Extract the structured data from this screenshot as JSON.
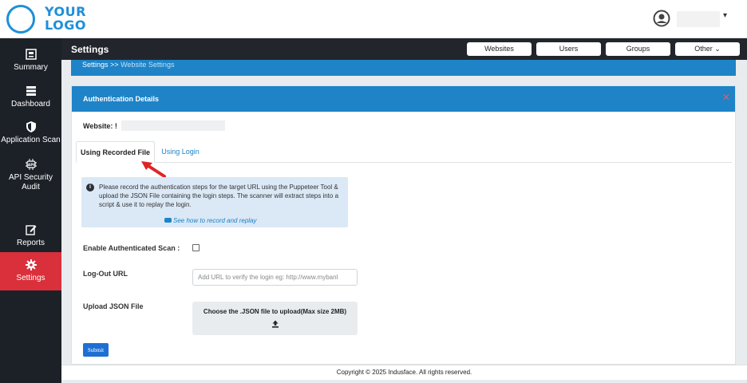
{
  "logo": {
    "line1": "YOUR",
    "line2": "LOGO",
    "color": "#1e8fd8"
  },
  "header": {
    "user_caret": "▾"
  },
  "sidebar": {
    "items": [
      {
        "label": "Summary",
        "icon": "summary-icon"
      },
      {
        "label": "Dashboard",
        "icon": "dashboard-icon"
      },
      {
        "label": "Application Scan",
        "icon": "shield-icon"
      },
      {
        "label": "API Security Audit",
        "icon": "api-icon"
      },
      {
        "label": "Reports",
        "icon": "edit-icon"
      },
      {
        "label": "Settings",
        "icon": "gear-icon",
        "active": true
      }
    ],
    "active_color": "#d9303b"
  },
  "titlebar": {
    "title": "Settings",
    "buttons": [
      "Websites",
      "Users",
      "Groups",
      "Other ⌄"
    ]
  },
  "breadcrumb": {
    "root": "Settings",
    "separator": ">>",
    "current": "Website Settings"
  },
  "card": {
    "title": "Authentication Details",
    "close_icon": "close-icon",
    "website_label": "Website: ",
    "website_value_prefix": "!"
  },
  "tabs": [
    {
      "label": "Using Recorded File",
      "active": true
    },
    {
      "label": "Using Login",
      "active": false
    }
  ],
  "info": {
    "text": "Please record the authentication steps for the target URL using the Puppeteer Tool & upload the JSON File containing the login steps. The scanner will extract steps into a script & use it to replay the login.",
    "link": "See how to record and replay"
  },
  "form": {
    "enable_label": "Enable Authenticated Scan :",
    "enable_checked": false,
    "logout_label": "Log-Out URL",
    "logout_placeholder": "Add URL to verify the login eg: http://www.mybanl",
    "upload_label": "Upload JSON File",
    "upload_text": "Choose the .JSON file to upload(Max size 2MB)",
    "submit_label": "Submit"
  },
  "footer": {
    "text": "Copyright © 2025 Indusface. All rights reserved."
  },
  "colors": {
    "primary": "#1e83c7",
    "dark": "#22262c",
    "sidebar": "#1c2128",
    "annotation_arrow": "#e02424"
  }
}
